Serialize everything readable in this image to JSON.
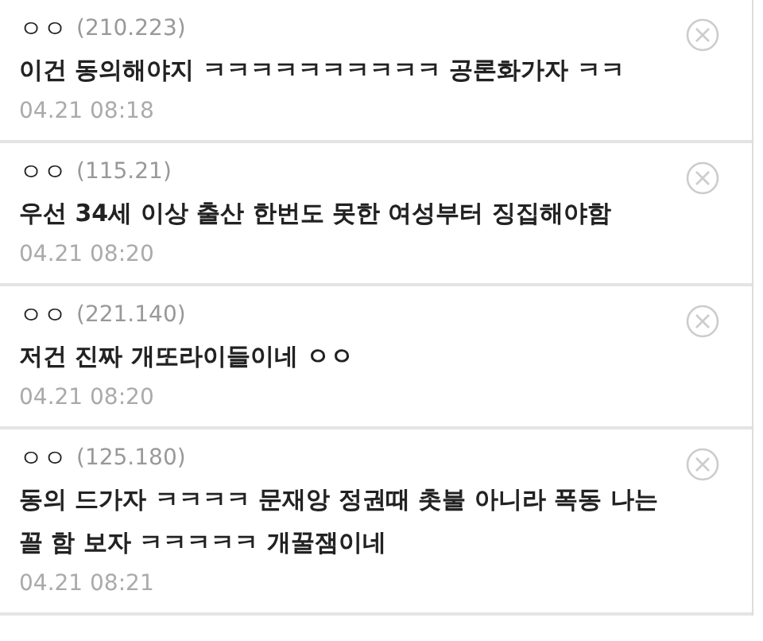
{
  "comments": [
    {
      "name": "ㅇㅇ",
      "ip": "(210.223)",
      "text": "이건 동의해야지 ㅋㅋㅋㅋㅋㅋㅋㅋㅋㅋ 공론화가자 ㅋㅋ",
      "time": "04.21 08:18"
    },
    {
      "name": "ㅇㅇ",
      "ip": "(115.21)",
      "text": "우선 34세 이상 출산 한번도 못한 여성부터 징집해야함",
      "time": "04.21 08:20"
    },
    {
      "name": "ㅇㅇ",
      "ip": "(221.140)",
      "text": "저건 진짜 개또라이들이네 ㅇㅇ",
      "time": "04.21 08:20"
    },
    {
      "name": "ㅇㅇ",
      "ip": "(125.180)",
      "text": "동의 드가자 ㅋㅋㅋㅋ 문재앙 정권때 촛불 아니라 폭동 나는 꼴 함 보자 ㅋㅋㅋㅋㅋ 개꿀잼이네",
      "time": "04.21 08:21"
    }
  ]
}
